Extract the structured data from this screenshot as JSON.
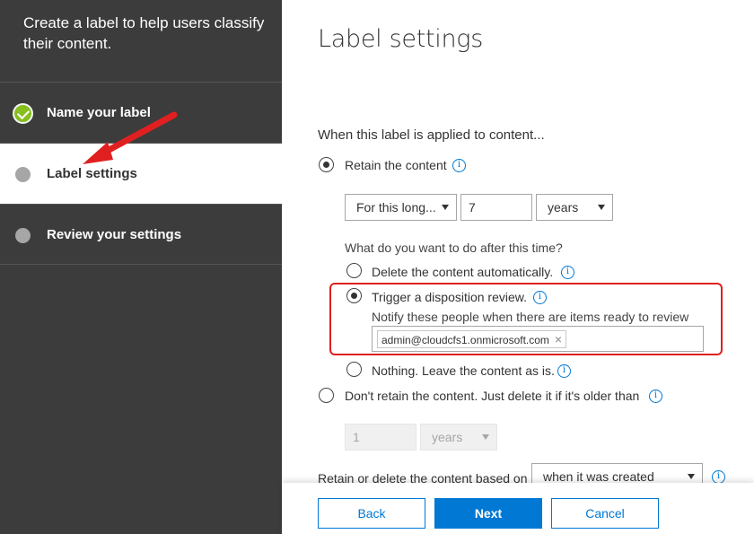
{
  "wizard": {
    "heading": "Create a label to help users classify their content.",
    "steps": [
      {
        "label": "Name your label",
        "state": "completed"
      },
      {
        "label": "Label settings",
        "state": "current"
      },
      {
        "label": "Review your settings",
        "state": "pending"
      }
    ]
  },
  "main": {
    "title": "Label settings",
    "applied_heading": "When this label is applied to content...",
    "retain_label": "Retain the content",
    "period_select": "For this long...",
    "period_value": "7",
    "period_unit": "years",
    "after_question": "What do you want to do after this time?",
    "option_delete": "Delete the content automatically.",
    "option_trigger": "Trigger a disposition review.",
    "notify_text": "Notify these people when there are items ready to review",
    "reviewer": "admin@cloudcfs1.onmicrosoft.com",
    "reviewer_remove": "×",
    "option_nothing": "Nothing. Leave the content as is.",
    "dont_retain_label": "Don't retain the content. Just delete it if it's older than",
    "delete_value": "1",
    "delete_unit": "years",
    "based_on_label": "Retain or delete the content based on",
    "based_on_select": "when it was created",
    "info_glyph": "i"
  },
  "footer": {
    "back": "Back",
    "next": "Next",
    "cancel": "Cancel"
  },
  "colors": {
    "accent": "#0078d4",
    "sidebar": "#3c3c3c",
    "check": "#86bf1e",
    "annotation": "#e02020"
  }
}
